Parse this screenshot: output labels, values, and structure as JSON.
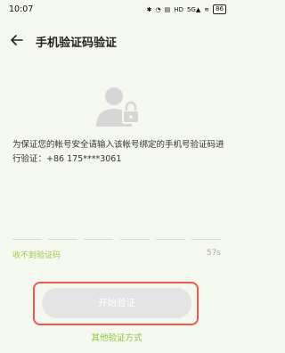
{
  "status_bar": {
    "time": "10:07",
    "icons": [
      "bell-icon",
      "alarm-icon",
      "network-speed",
      "hd-icon",
      "5g-signal-icon",
      "wifi-icon"
    ],
    "speed": "371\nKB/s",
    "battery": "86"
  },
  "toolbar": {
    "title": "手机验证码验证"
  },
  "description": "为保证您的帐号安全请输入该帐号绑定的手机号验证码进行验证：+86 175****3061",
  "code_box_count": 6,
  "no_code_label": "收不到验证码",
  "countdown": "57s",
  "start_button_label": "开始验证",
  "other_methods_label": "其他验证方式",
  "colors": {
    "background": "#f5f8ee",
    "accent": "#8cc33f",
    "highlight": "#f05a4a",
    "button_disabled": "#e4e4e4"
  }
}
